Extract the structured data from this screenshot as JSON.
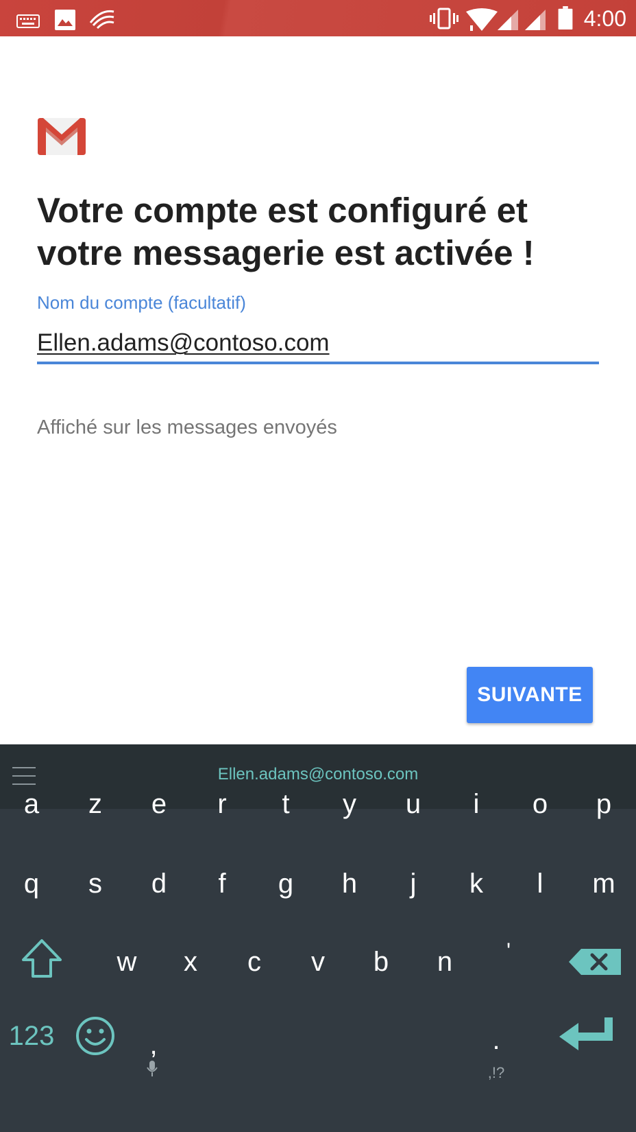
{
  "status_bar": {
    "time": "4:00",
    "left_icons": [
      "keyboard-icon",
      "image-icon",
      "swiftkey-icon"
    ],
    "right_icons": [
      "vibrate-icon",
      "wifi-icon",
      "signal-icon",
      "signal-icon-2",
      "battery-icon"
    ]
  },
  "app": {
    "logo": "gmail-logo",
    "title": "Votre compte est configuré et votre messagerie est activée !",
    "account_field": {
      "label": "Nom du compte (facultatif)",
      "value": "Ellen.adams@contoso.com",
      "helper": "Affiché sur les messages envoyés"
    },
    "next_button": "SUIVANTE"
  },
  "keyboard": {
    "suggestion": "Ellen.adams@contoso.com",
    "row1": [
      "a",
      "z",
      "e",
      "r",
      "t",
      "y",
      "u",
      "i",
      "o",
      "p"
    ],
    "row2": [
      "q",
      "s",
      "d",
      "f",
      "g",
      "h",
      "j",
      "k",
      "l",
      "m"
    ],
    "row3": [
      "w",
      "x",
      "c",
      "v",
      "b",
      "n",
      "'"
    ],
    "numbers_key": "123",
    "comma_key": ",",
    "period_key": ".",
    "punct_hint": ",!?",
    "accent_color": "#6cc4bf"
  }
}
